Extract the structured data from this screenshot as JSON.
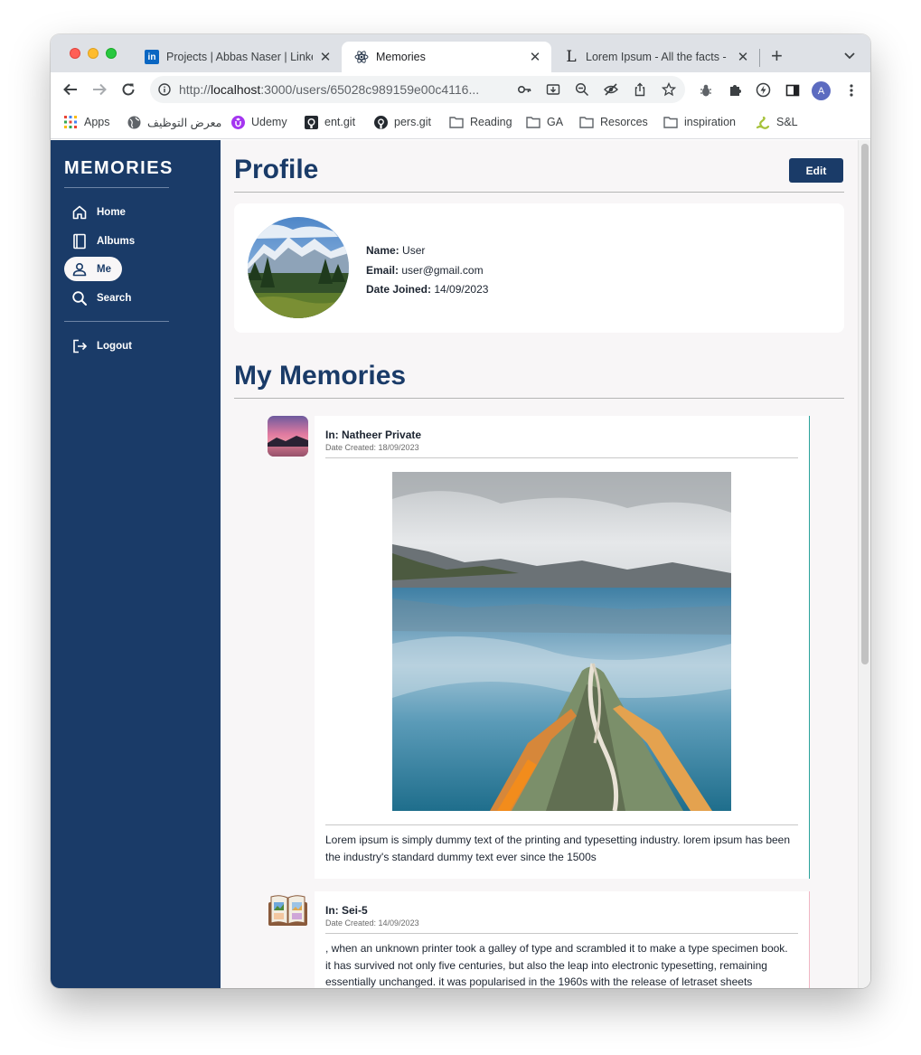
{
  "browser": {
    "tabs": [
      {
        "title": "Projects | Abbas Naser | LinkedIn",
        "favicon": "linkedin-icon"
      },
      {
        "title": "Memories",
        "favicon": "react-icon"
      },
      {
        "title": "Lorem Ipsum - All the facts - Lipsum generator",
        "favicon": "lipsum-icon"
      }
    ],
    "url_prefix": "http://",
    "url_host": "localhost",
    "url_rest": ":3000/users/65028c989159e00c4116...",
    "profile_initial": "A",
    "bookmarks": [
      {
        "label": "Apps",
        "icon": "apps-grid-icon"
      },
      {
        "label": "معرض التوظيف",
        "icon": "globe-icon"
      },
      {
        "label": "Udemy",
        "icon": "udemy-icon"
      },
      {
        "label": "ent.git",
        "icon": "github-icon"
      },
      {
        "label": "pers.git",
        "icon": "github-icon"
      },
      {
        "label": "Reading",
        "icon": "folder-icon"
      },
      {
        "label": "GA",
        "icon": "folder-icon"
      },
      {
        "label": "Resorces",
        "icon": "folder-icon"
      },
      {
        "label": "inspiration",
        "icon": "folder-icon"
      },
      {
        "label": "S&L",
        "icon": "snake-icon"
      }
    ]
  },
  "sidebar": {
    "brand": "MEMORIES",
    "items": [
      {
        "label": "Home",
        "icon": "home-icon"
      },
      {
        "label": "Albums",
        "icon": "album-icon"
      },
      {
        "label": "Me",
        "icon": "user-icon",
        "active": true
      },
      {
        "label": "Search",
        "icon": "search-icon"
      }
    ],
    "logout": {
      "label": "Logout",
      "icon": "logout-icon"
    }
  },
  "profile": {
    "title": "Profile",
    "edit_label": "Edit",
    "name_label": "Name:",
    "name": "User",
    "email_label": "Email:",
    "email": "user@gmail.com",
    "joined_label": "Date Joined:",
    "joined": "14/09/2023"
  },
  "memories": {
    "title": "My Memories",
    "items": [
      {
        "album": "In: Natheer Private",
        "date": "Date Created: 18/09/2023",
        "text": "Lorem ipsum is simply dummy text of the printing and typesetting industry. lorem ipsum has been the industry's standard dummy text ever since the 1500s",
        "accent": "#2ba39b"
      },
      {
        "album": "In: Sei-5",
        "date": "Date Created: 14/09/2023",
        "text": ", when an unknown printer took a galley of type and scrambled it to make a type specimen book. it has survived not only five centuries, but also the leap into electronic typesetting, remaining essentially unchanged. it was popularised in the 1960s with the release of letraset sheets containing",
        "accent": "#f0b6c4"
      }
    ]
  },
  "colors": {
    "sidebar": "#1a3b68",
    "accent": "#1a3b68",
    "page_bg": "#f8f6f7"
  }
}
